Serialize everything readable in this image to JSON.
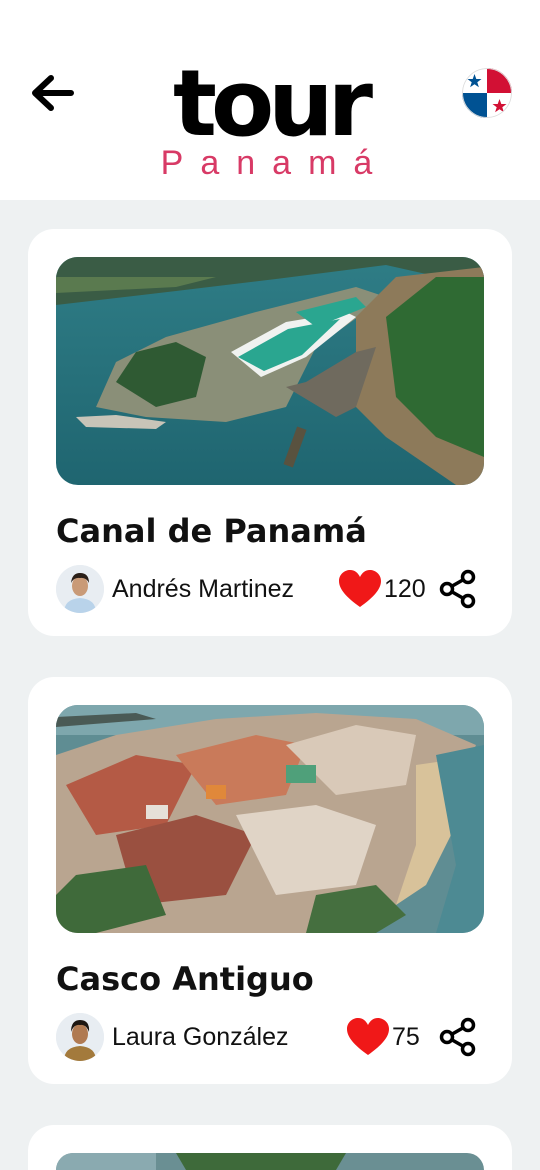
{
  "header": {
    "logo_main": "tour",
    "logo_sub": "Panamá",
    "back_icon": "arrow-left-icon",
    "flag_icon": "panama-flag-icon"
  },
  "colors": {
    "brand_pink": "#d83a66",
    "heart_red": "#f01818",
    "background": "#eef1f2"
  },
  "cards": [
    {
      "title": "Canal de Panamá",
      "author": "Andrés Martinez",
      "likes": "120",
      "image_icon": "canal-photo",
      "share_icon": "share-icon"
    },
    {
      "title": "Casco Antiguo",
      "author": "Laura González",
      "likes": "75",
      "image_icon": "casco-antiguo-photo",
      "share_icon": "share-icon"
    }
  ]
}
